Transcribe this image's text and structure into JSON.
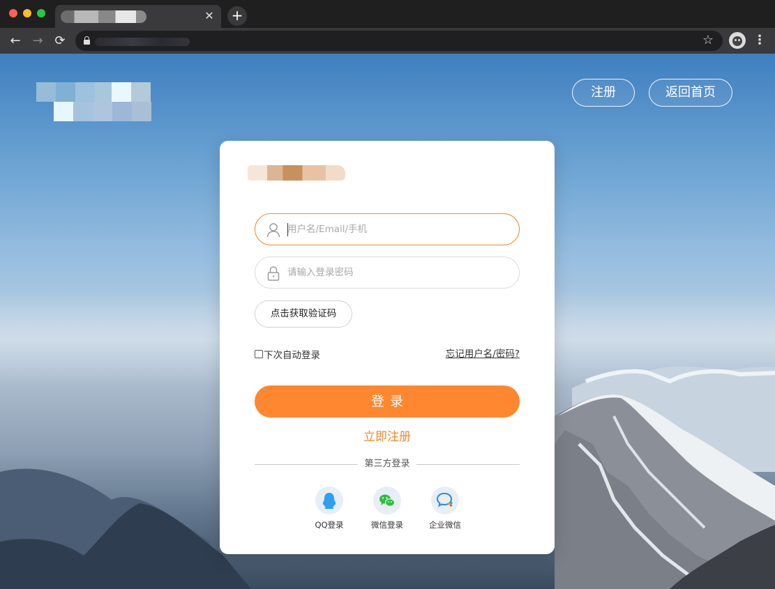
{
  "browser": {
    "tab_close": "✕",
    "new_tab": "+",
    "back": "←",
    "forward": "→",
    "reload": "⟳",
    "bookmark": "☆",
    "menu": "⋮"
  },
  "header": {
    "register_label": "注册",
    "home_label": "返回首页"
  },
  "login": {
    "username_placeholder": "用户名/Email/手机",
    "password_placeholder": "请输入登录密码",
    "captcha_label": "点击获取验证码",
    "remember_label": "下次自动登录",
    "forgot_label": "忘记用户名/密码?",
    "submit_label": "登录",
    "signup_label": "立即注册",
    "third_party_label": "第三方登录"
  },
  "social": [
    {
      "label": "QQ登录",
      "icon": "qq-icon",
      "color": "#2da1f0"
    },
    {
      "label": "微信登录",
      "icon": "wechat-icon",
      "color": "#2dbf3a"
    },
    {
      "label": "企业微信",
      "icon": "wework-icon",
      "color": "#2c87e8"
    }
  ],
  "colors": {
    "accent": "#ff8730",
    "input_focus_border": "#f5872d"
  }
}
